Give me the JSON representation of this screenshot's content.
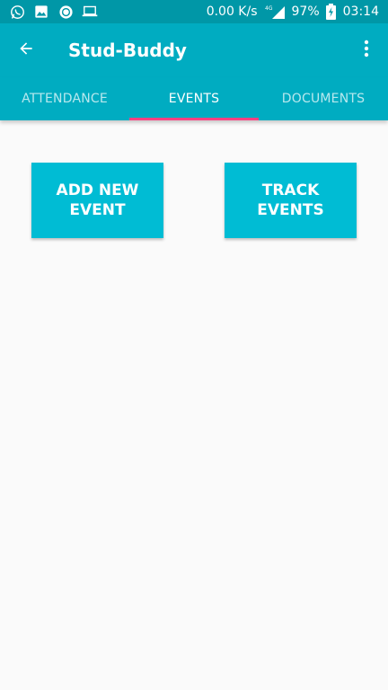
{
  "status_bar": {
    "icons_left": [
      "whatsapp-icon",
      "image-icon",
      "record-icon",
      "laptop-icon"
    ],
    "network_speed": "0.00 K/s",
    "network_type": "4G",
    "battery_percent": "97%",
    "time": "03:14"
  },
  "app_bar": {
    "title": "Stud-Buddy",
    "back_icon": "arrow-left-icon",
    "overflow_icon": "more-vert-icon"
  },
  "tabs": [
    {
      "label": "ATTENDANCE",
      "active": false
    },
    {
      "label": "EVENTS",
      "active": true
    },
    {
      "label": "DOCUMENTS",
      "active": false
    }
  ],
  "actions": {
    "add_event_label": "ADD NEW EVENT",
    "track_events_label": "TRACK EVENTS"
  },
  "colors": {
    "status_bar": "#0097A7",
    "primary": "#00ACC1",
    "button": "#00BCD4",
    "tab_indicator": "#FF4081",
    "background": "#FAFAFA"
  }
}
